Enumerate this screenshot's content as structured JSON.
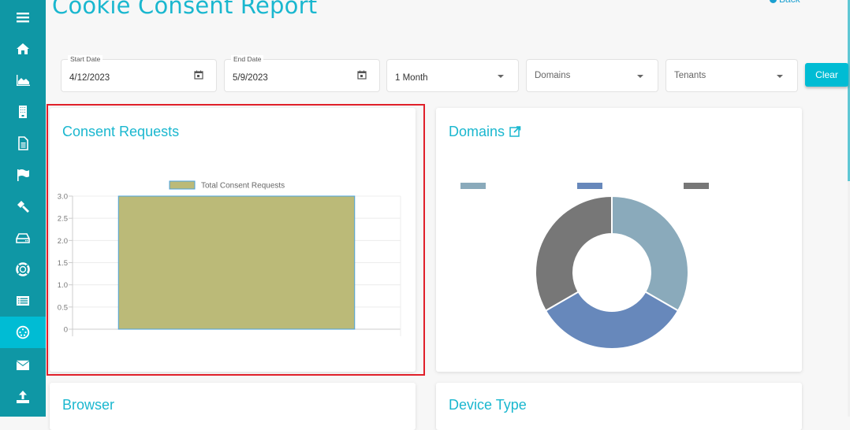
{
  "page": {
    "title": "Cookie Consent Report",
    "back_label": "Back"
  },
  "sidebar": {
    "items": [
      {
        "icon": "menu-icon"
      },
      {
        "icon": "home-icon"
      },
      {
        "icon": "area-chart-icon"
      },
      {
        "icon": "building-icon"
      },
      {
        "icon": "document-icon"
      },
      {
        "icon": "flag-icon"
      },
      {
        "icon": "gavel-icon"
      },
      {
        "icon": "hard-drive-icon"
      },
      {
        "icon": "life-ring-icon"
      },
      {
        "icon": "list-icon"
      },
      {
        "icon": "cookie-icon",
        "active": true
      },
      {
        "icon": "envelope-icon"
      },
      {
        "icon": "upload-icon"
      }
    ]
  },
  "filters": {
    "start_date": {
      "label": "Start Date",
      "value": "4/12/2023"
    },
    "end_date": {
      "label": "End Date",
      "value": "5/9/2023"
    },
    "period": {
      "value": "1 Month"
    },
    "domains": {
      "placeholder": "Domains"
    },
    "tenants": {
      "placeholder": "Tenants"
    },
    "clear_label": "Clear"
  },
  "cards": {
    "consent_requests": {
      "title": "Consent Requests"
    },
    "domains": {
      "title": "Domains"
    },
    "browser": {
      "title": "Browser"
    },
    "device_type": {
      "title": "Device Type"
    }
  },
  "chart_data": [
    {
      "type": "bar",
      "title": "Consent Requests",
      "categories": [
        ""
      ],
      "series": [
        {
          "name": "Total Consent Requests",
          "values": [
            3
          ],
          "color": "#bbba78",
          "border": "#4aa3df"
        }
      ],
      "yticks": [
        "0",
        "0.5",
        "1.0",
        "1.5",
        "2.0",
        "2.5",
        "3.0"
      ],
      "ylim": [
        0,
        3
      ],
      "grid": true,
      "legend": "top"
    },
    {
      "type": "pie",
      "title": "Domains",
      "donut": true,
      "slices": [
        {
          "label": "",
          "value": 1,
          "color": "#8aaabb"
        },
        {
          "label": "",
          "value": 1,
          "color": "#6788bb"
        },
        {
          "label": "",
          "value": 1,
          "color": "#777777"
        }
      ],
      "legend": "top"
    }
  ]
}
